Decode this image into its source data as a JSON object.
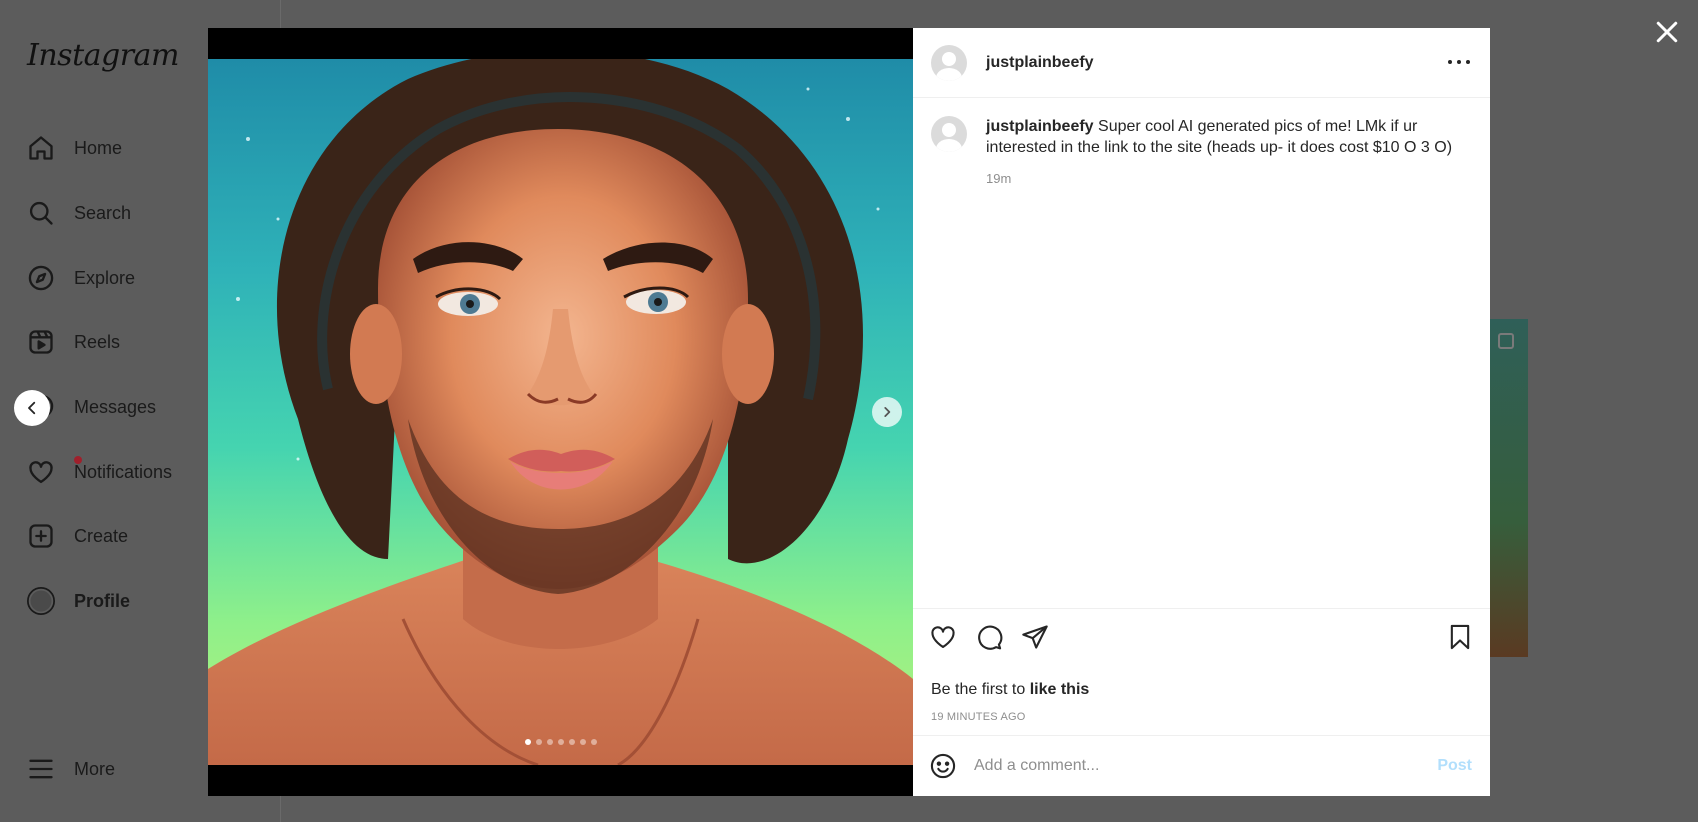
{
  "sidebar": {
    "logo": "Instagram",
    "items": [
      {
        "label": "Home",
        "icon": "home-icon"
      },
      {
        "label": "Search",
        "icon": "search-icon"
      },
      {
        "label": "Explore",
        "icon": "compass-icon"
      },
      {
        "label": "Reels",
        "icon": "reels-icon"
      },
      {
        "label": "Messages",
        "icon": "messenger-icon"
      },
      {
        "label": "Notifications",
        "icon": "heart-icon"
      },
      {
        "label": "Create",
        "icon": "plus-square-icon"
      },
      {
        "label": "Profile",
        "icon": "avatar-icon"
      }
    ],
    "more_label": "More"
  },
  "post": {
    "username": "justplainbeefy",
    "caption_user": "justplainbeefy",
    "caption_text": " Super cool AI generated pics of me! LMk if ur interested in the link to the site (heads up- it does cost $10 O 3 O)",
    "caption_time": "19m",
    "likes_prefix": "Be the first to ",
    "likes_bold": "like this",
    "timestamp": "19 MINUTES AGO",
    "carousel_count": 7,
    "carousel_active": 1
  },
  "comment_box": {
    "placeholder": "Add a comment...",
    "post_label": "Post"
  },
  "colors": {
    "overlay": "#5c5c5c",
    "post_button": "#b2dffc",
    "notification_dot": "#a0202c"
  }
}
